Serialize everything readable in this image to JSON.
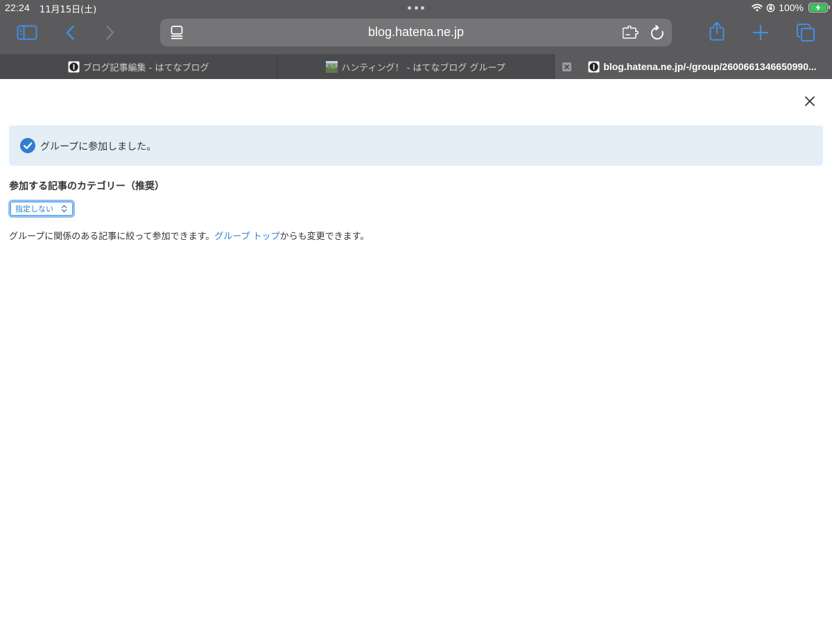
{
  "status_bar": {
    "time": "22:24",
    "date": "11月15日(土)",
    "battery": "100%"
  },
  "browser": {
    "url": "blog.hatena.ne.jp",
    "tabs": [
      {
        "title": "ブログ記事編集 - はてなブログ",
        "favicon": "hatena-icon",
        "active": false
      },
      {
        "title": "ハンティング！ - はてなブログ グループ",
        "favicon": "thumbnail-image",
        "active": false
      },
      {
        "title": "blog.hatena.ne.jp/-/group/2600661346650990...",
        "favicon": "hatena-icon",
        "active": true
      }
    ],
    "toolbar_icons": [
      "sidebar-icon",
      "back-icon",
      "forward-icon",
      "reader-icon",
      "extension-icon",
      "reload-icon",
      "share-icon",
      "new-tab-icon",
      "tabs-overview-icon"
    ]
  },
  "page": {
    "notice": "グループに参加しました。",
    "category_heading": "参加する記事のカテゴリー（推奨）",
    "category_select_value": "指定しない",
    "help_text_before": "グループに関係のある記事に絞って参加できます。",
    "help_link": "グループ トップ",
    "help_text_after": "からも変更できます。"
  },
  "colors": {
    "chrome_bg": "#5b5b5d",
    "tabbar_bg": "#4a4a4c",
    "accent_blue": "#2f7fd0",
    "toolbar_blue": "#3f8fe8",
    "notice_bg": "#e4eef7",
    "battery_green": "#34c759"
  }
}
